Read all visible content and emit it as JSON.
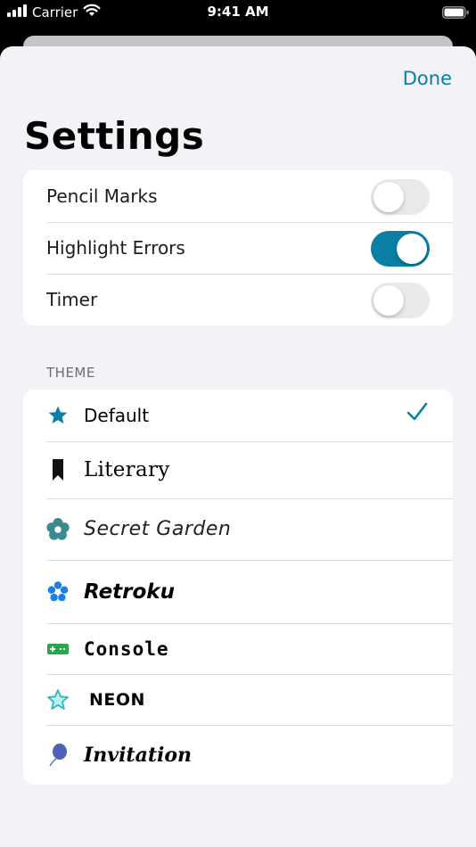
{
  "status_bar": {
    "carrier": "Carrier",
    "time": "9:41 AM"
  },
  "header": {
    "done_label": "Done",
    "title": "Settings"
  },
  "settings": [
    {
      "label": "Pencil Marks",
      "enabled": false
    },
    {
      "label": "Highlight Errors",
      "enabled": true
    },
    {
      "label": "Timer",
      "enabled": false
    }
  ],
  "theme_section": {
    "header": "THEME",
    "selected": "Default",
    "items": [
      {
        "label": "Default",
        "icon": "star-icon"
      },
      {
        "label": "Literary",
        "icon": "bookmark-icon"
      },
      {
        "label": "Secret Garden",
        "icon": "flower-icon"
      },
      {
        "label": "Retroku",
        "icon": "asterisk-icon"
      },
      {
        "label": "Console",
        "icon": "gamepad-icon"
      },
      {
        "label": "NEON",
        "icon": "star-outline-icon"
      },
      {
        "label": "Invitation",
        "icon": "balloon-icon"
      }
    ]
  },
  "colors": {
    "accent": "#0a7ea4",
    "background": "#f2f2f7",
    "toggle_off": "#e9e9eb"
  }
}
